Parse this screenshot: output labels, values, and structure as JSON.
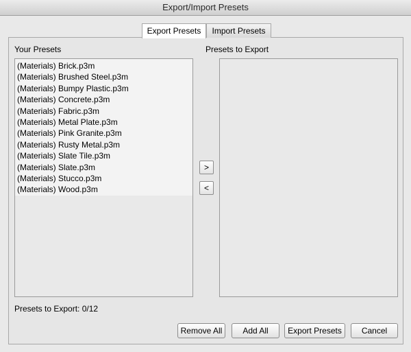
{
  "window": {
    "title": "Export/Import Presets"
  },
  "tabs": [
    {
      "label": "Export Presets",
      "active": true
    },
    {
      "label": "Import Presets",
      "active": false
    }
  ],
  "your_presets": {
    "heading": "Your Presets",
    "items": [
      "(Materials)  Brick.p3m",
      "(Materials)  Brushed Steel.p3m",
      "(Materials)  Bumpy Plastic.p3m",
      "(Materials)  Concrete.p3m",
      "(Materials)  Fabric.p3m",
      "(Materials)  Metal Plate.p3m",
      "(Materials)  Pink Granite.p3m",
      "(Materials)  Rusty Metal.p3m",
      "(Materials)  Slate Tile.p3m",
      "(Materials)  Slate.p3m",
      "(Materials)  Stucco.p3m",
      "(Materials)  Wood.p3m"
    ]
  },
  "export_list": {
    "heading": "Presets to Export",
    "items": []
  },
  "transfer": {
    "add_label": ">",
    "remove_label": "<"
  },
  "status": {
    "text": "Presets to Export: 0/12"
  },
  "buttons": {
    "remove_all": "Remove All",
    "add_all": "Add All",
    "export_presets": "Export Presets",
    "cancel": "Cancel"
  }
}
